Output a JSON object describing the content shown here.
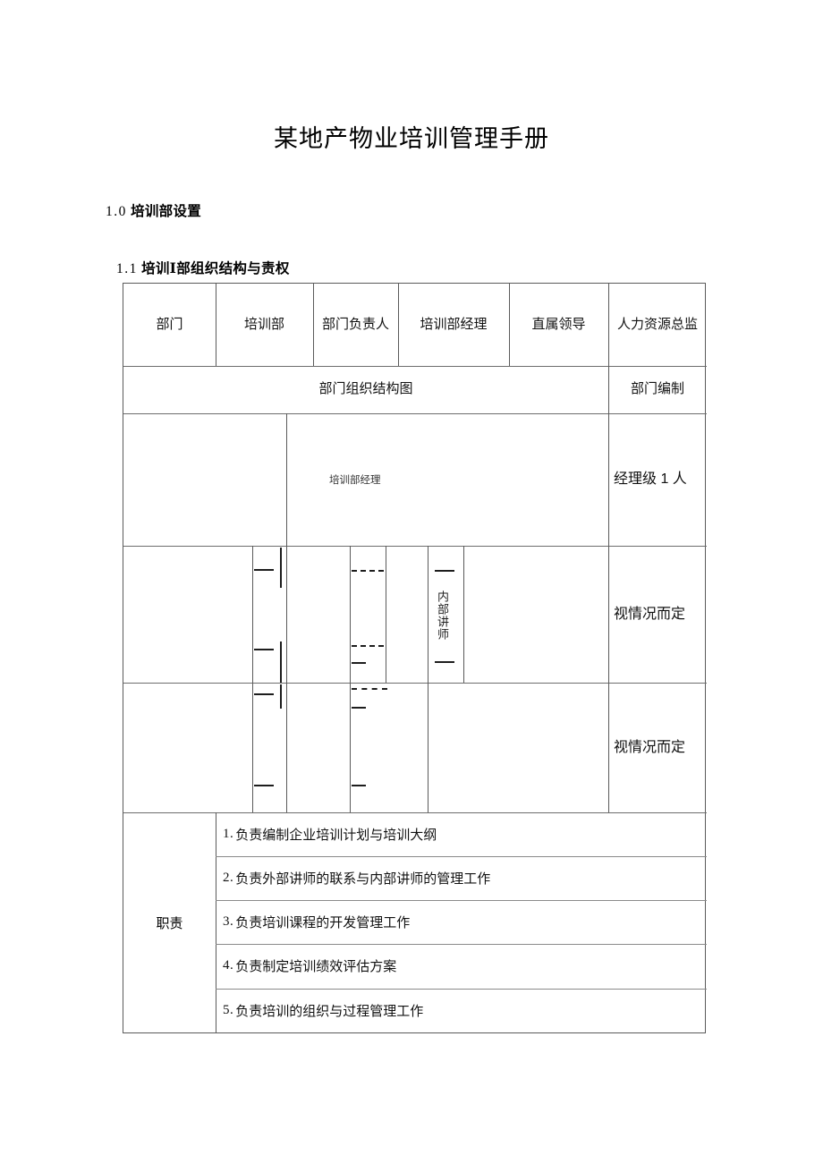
{
  "document": {
    "title": "某地产物业培训管理手册",
    "section_1": {
      "number": "1.0",
      "title": "培训部设置"
    },
    "section_1_1": {
      "number": "1.1",
      "title": "培训Ⅰ部组织结构与责权"
    }
  },
  "table": {
    "header": {
      "dept_label": "部门",
      "dept_value": "培训部",
      "owner_label": "部门负责人",
      "owner_value": "培训部经理",
      "supervisor_label": "直属领导",
      "supervisor_value": "人力资源总监"
    },
    "subheader": {
      "org_chart_label": "部门组织结构图",
      "headcount_label": "部门编制"
    },
    "org_chart": {
      "manager_node": "培训部经理",
      "internal_trainer_node": "内部讲师"
    },
    "headcount": {
      "row_manager": "经理级 1 人",
      "row_two": "视情况而定",
      "row_three": "视情况而定"
    },
    "responsibilities": {
      "label": "职责",
      "items": [
        {
          "index": "1.",
          "text": "负责编制企业培训计划与培训大纲"
        },
        {
          "index": "2.",
          "text": "负责外部讲师的联系与内部讲师的管理工作"
        },
        {
          "index": "3.",
          "text": "负责培训课程的开发管理工作"
        },
        {
          "index": "4.",
          "text": "负责制定培训绩效评估方案"
        },
        {
          "index": "5.",
          "text": "负责培训的组织与过程管理工作"
        }
      ]
    }
  }
}
